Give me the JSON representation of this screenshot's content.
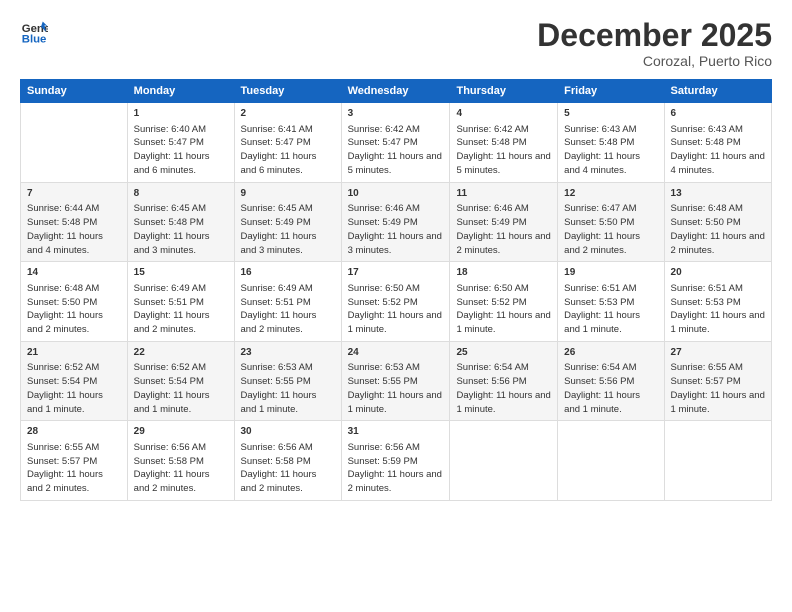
{
  "header": {
    "logo_line1": "General",
    "logo_line2": "Blue",
    "month": "December 2025",
    "location": "Corozal, Puerto Rico"
  },
  "days_of_week": [
    "Sunday",
    "Monday",
    "Tuesday",
    "Wednesday",
    "Thursday",
    "Friday",
    "Saturday"
  ],
  "weeks": [
    [
      {
        "day": "",
        "sunrise": "",
        "sunset": "",
        "daylight": ""
      },
      {
        "day": "1",
        "sunrise": "Sunrise: 6:40 AM",
        "sunset": "Sunset: 5:47 PM",
        "daylight": "Daylight: 11 hours and 6 minutes."
      },
      {
        "day": "2",
        "sunrise": "Sunrise: 6:41 AM",
        "sunset": "Sunset: 5:47 PM",
        "daylight": "Daylight: 11 hours and 6 minutes."
      },
      {
        "day": "3",
        "sunrise": "Sunrise: 6:42 AM",
        "sunset": "Sunset: 5:47 PM",
        "daylight": "Daylight: 11 hours and 5 minutes."
      },
      {
        "day": "4",
        "sunrise": "Sunrise: 6:42 AM",
        "sunset": "Sunset: 5:48 PM",
        "daylight": "Daylight: 11 hours and 5 minutes."
      },
      {
        "day": "5",
        "sunrise": "Sunrise: 6:43 AM",
        "sunset": "Sunset: 5:48 PM",
        "daylight": "Daylight: 11 hours and 4 minutes."
      },
      {
        "day": "6",
        "sunrise": "Sunrise: 6:43 AM",
        "sunset": "Sunset: 5:48 PM",
        "daylight": "Daylight: 11 hours and 4 minutes."
      }
    ],
    [
      {
        "day": "7",
        "sunrise": "Sunrise: 6:44 AM",
        "sunset": "Sunset: 5:48 PM",
        "daylight": "Daylight: 11 hours and 4 minutes."
      },
      {
        "day": "8",
        "sunrise": "Sunrise: 6:45 AM",
        "sunset": "Sunset: 5:48 PM",
        "daylight": "Daylight: 11 hours and 3 minutes."
      },
      {
        "day": "9",
        "sunrise": "Sunrise: 6:45 AM",
        "sunset": "Sunset: 5:49 PM",
        "daylight": "Daylight: 11 hours and 3 minutes."
      },
      {
        "day": "10",
        "sunrise": "Sunrise: 6:46 AM",
        "sunset": "Sunset: 5:49 PM",
        "daylight": "Daylight: 11 hours and 3 minutes."
      },
      {
        "day": "11",
        "sunrise": "Sunrise: 6:46 AM",
        "sunset": "Sunset: 5:49 PM",
        "daylight": "Daylight: 11 hours and 2 minutes."
      },
      {
        "day": "12",
        "sunrise": "Sunrise: 6:47 AM",
        "sunset": "Sunset: 5:50 PM",
        "daylight": "Daylight: 11 hours and 2 minutes."
      },
      {
        "day": "13",
        "sunrise": "Sunrise: 6:48 AM",
        "sunset": "Sunset: 5:50 PM",
        "daylight": "Daylight: 11 hours and 2 minutes."
      }
    ],
    [
      {
        "day": "14",
        "sunrise": "Sunrise: 6:48 AM",
        "sunset": "Sunset: 5:50 PM",
        "daylight": "Daylight: 11 hours and 2 minutes."
      },
      {
        "day": "15",
        "sunrise": "Sunrise: 6:49 AM",
        "sunset": "Sunset: 5:51 PM",
        "daylight": "Daylight: 11 hours and 2 minutes."
      },
      {
        "day": "16",
        "sunrise": "Sunrise: 6:49 AM",
        "sunset": "Sunset: 5:51 PM",
        "daylight": "Daylight: 11 hours and 2 minutes."
      },
      {
        "day": "17",
        "sunrise": "Sunrise: 6:50 AM",
        "sunset": "Sunset: 5:52 PM",
        "daylight": "Daylight: 11 hours and 1 minute."
      },
      {
        "day": "18",
        "sunrise": "Sunrise: 6:50 AM",
        "sunset": "Sunset: 5:52 PM",
        "daylight": "Daylight: 11 hours and 1 minute."
      },
      {
        "day": "19",
        "sunrise": "Sunrise: 6:51 AM",
        "sunset": "Sunset: 5:53 PM",
        "daylight": "Daylight: 11 hours and 1 minute."
      },
      {
        "day": "20",
        "sunrise": "Sunrise: 6:51 AM",
        "sunset": "Sunset: 5:53 PM",
        "daylight": "Daylight: 11 hours and 1 minute."
      }
    ],
    [
      {
        "day": "21",
        "sunrise": "Sunrise: 6:52 AM",
        "sunset": "Sunset: 5:54 PM",
        "daylight": "Daylight: 11 hours and 1 minute."
      },
      {
        "day": "22",
        "sunrise": "Sunrise: 6:52 AM",
        "sunset": "Sunset: 5:54 PM",
        "daylight": "Daylight: 11 hours and 1 minute."
      },
      {
        "day": "23",
        "sunrise": "Sunrise: 6:53 AM",
        "sunset": "Sunset: 5:55 PM",
        "daylight": "Daylight: 11 hours and 1 minute."
      },
      {
        "day": "24",
        "sunrise": "Sunrise: 6:53 AM",
        "sunset": "Sunset: 5:55 PM",
        "daylight": "Daylight: 11 hours and 1 minute."
      },
      {
        "day": "25",
        "sunrise": "Sunrise: 6:54 AM",
        "sunset": "Sunset: 5:56 PM",
        "daylight": "Daylight: 11 hours and 1 minute."
      },
      {
        "day": "26",
        "sunrise": "Sunrise: 6:54 AM",
        "sunset": "Sunset: 5:56 PM",
        "daylight": "Daylight: 11 hours and 1 minute."
      },
      {
        "day": "27",
        "sunrise": "Sunrise: 6:55 AM",
        "sunset": "Sunset: 5:57 PM",
        "daylight": "Daylight: 11 hours and 1 minute."
      }
    ],
    [
      {
        "day": "28",
        "sunrise": "Sunrise: 6:55 AM",
        "sunset": "Sunset: 5:57 PM",
        "daylight": "Daylight: 11 hours and 2 minutes."
      },
      {
        "day": "29",
        "sunrise": "Sunrise: 6:56 AM",
        "sunset": "Sunset: 5:58 PM",
        "daylight": "Daylight: 11 hours and 2 minutes."
      },
      {
        "day": "30",
        "sunrise": "Sunrise: 6:56 AM",
        "sunset": "Sunset: 5:58 PM",
        "daylight": "Daylight: 11 hours and 2 minutes."
      },
      {
        "day": "31",
        "sunrise": "Sunrise: 6:56 AM",
        "sunset": "Sunset: 5:59 PM",
        "daylight": "Daylight: 11 hours and 2 minutes."
      },
      {
        "day": "",
        "sunrise": "",
        "sunset": "",
        "daylight": ""
      },
      {
        "day": "",
        "sunrise": "",
        "sunset": "",
        "daylight": ""
      },
      {
        "day": "",
        "sunrise": "",
        "sunset": "",
        "daylight": ""
      }
    ]
  ]
}
